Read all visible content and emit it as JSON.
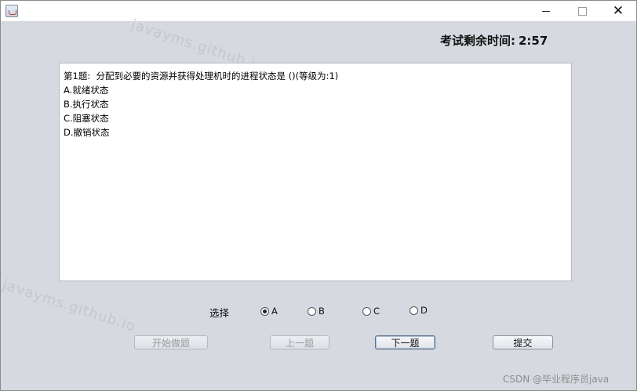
{
  "window": {
    "title_icon": "java-cup-icon",
    "controls": [
      "minimize",
      "maximize",
      "close"
    ]
  },
  "watermark": "javayms.github.io",
  "timer": {
    "label": "考试剩余时间:",
    "value": "2:57"
  },
  "question": {
    "text": "第1题:  分配到必要的资源并获得处理机时的进程状态是 ()(等级为:1)",
    "options": [
      "A.就绪状态",
      "B.执行状态",
      "C.阻塞状态",
      "D.撤销状态"
    ]
  },
  "answer": {
    "label": "选择",
    "choices": [
      {
        "label": "A",
        "selected": true
      },
      {
        "label": "B",
        "selected": false
      },
      {
        "label": "C",
        "selected": false
      },
      {
        "label": "D",
        "selected": false
      }
    ]
  },
  "buttons": {
    "start": {
      "label": "开始做题",
      "enabled": false
    },
    "prev": {
      "label": "上一题",
      "enabled": false
    },
    "next": {
      "label": "下一题",
      "enabled": true
    },
    "submit": {
      "label": "提交",
      "enabled": true
    }
  },
  "credit": "CSDN @毕业程序员java"
}
